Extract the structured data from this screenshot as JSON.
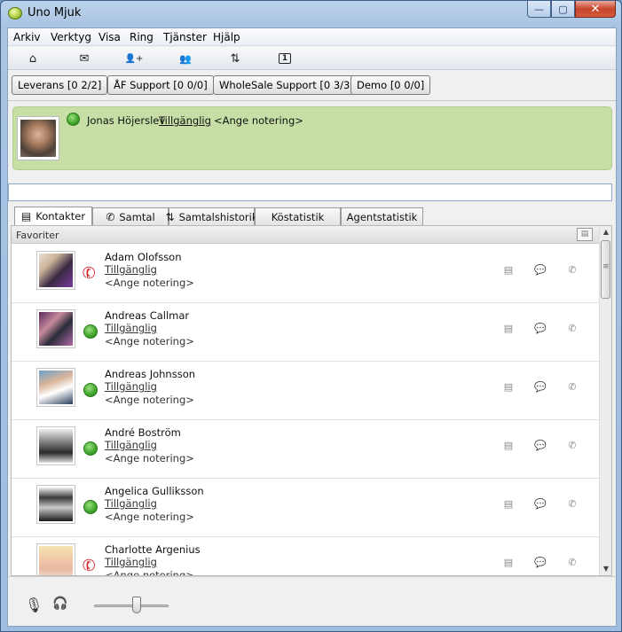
{
  "window": {
    "title": "Uno Mjuk",
    "minimize": "—",
    "maximize": "▢",
    "close": "✕"
  },
  "menu": [
    "Arkiv",
    "Verktyg",
    "Visa",
    "Ring",
    "Tjänster",
    "Hjälp"
  ],
  "toolbar": [
    {
      "icon": "home-icon",
      "glyph": "⌂"
    },
    {
      "icon": "mail-icon",
      "glyph": "✉"
    },
    {
      "icon": "add-contact-icon",
      "glyph": "👤+"
    },
    {
      "icon": "group-icon",
      "glyph": "👥"
    },
    {
      "icon": "transfer-icon",
      "glyph": "⇅"
    },
    {
      "icon": "queue-count-icon",
      "glyph": "1"
    }
  ],
  "queues": [
    "Leverans [0 2/2]",
    "ÅF Support [0 0/0]",
    "WholeSale Support [0 3/3]",
    "Demo [0 0/0]"
  ],
  "profile": {
    "name": "Jonas Höjerslev",
    "status": "Tillgänglig",
    "note": "<Ange notering>",
    "status_color": "#3da32a"
  },
  "tabs": [
    {
      "label": "Kontakter",
      "icon": "contacts-icon",
      "glyph": "▤"
    },
    {
      "label": "Samtal",
      "icon": "phone-icon",
      "glyph": "✆"
    },
    {
      "label": "Samtalshistorik",
      "icon": "history-icon",
      "glyph": "⇅"
    },
    {
      "label": "Köstatistik"
    },
    {
      "label": "Agentstatistik"
    }
  ],
  "favorites": {
    "label": "Favoriter",
    "contacts": [
      {
        "name": "Adam Olofsson",
        "status": "Tillgänglig",
        "note": "<Ange notering>",
        "presence": "on-call"
      },
      {
        "name": "Andreas Callmar",
        "status": "Tillgänglig",
        "note": "<Ange notering>",
        "presence": "available"
      },
      {
        "name": "Andreas Johnsson",
        "status": "Tillgänglig",
        "note": "<Ange notering>",
        "presence": "available"
      },
      {
        "name": "André Boström",
        "status": "Tillgänglig",
        "note": "<Ange notering>",
        "presence": "available"
      },
      {
        "name": "Angelica Gulliksson",
        "status": "Tillgänglig",
        "note": "<Ange notering>",
        "presence": "available"
      },
      {
        "name": "Charlotte Argenius",
        "status": "Tillgänglig",
        "note": "<Ange notering>",
        "presence": "on-call"
      }
    ]
  },
  "colors": {
    "available": "#3da32a",
    "on_call": "#d4262b",
    "profile_bg": "#c7dfa6"
  }
}
